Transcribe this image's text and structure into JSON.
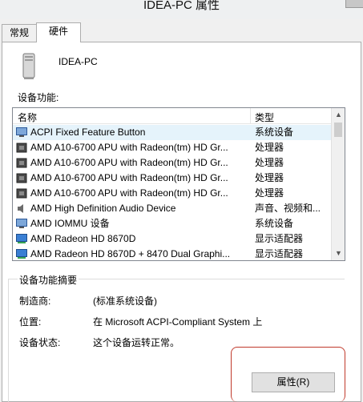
{
  "window": {
    "title": "IDEA-PC 属性"
  },
  "tabs": [
    {
      "label": "常规"
    },
    {
      "label": "硬件"
    }
  ],
  "computer": {
    "name": "IDEA-PC",
    "icon": "computer-tower-icon"
  },
  "device_functions": {
    "label": "设备功能:",
    "columns": {
      "name": "名称",
      "type": "类型"
    },
    "rows": [
      {
        "name": "ACPI Fixed Feature Button",
        "type": "系统设备",
        "icon": "system-device-icon"
      },
      {
        "name": "AMD A10-6700 APU with Radeon(tm) HD Gr...",
        "type": "处理器",
        "icon": "processor-icon"
      },
      {
        "name": "AMD A10-6700 APU with Radeon(tm) HD Gr...",
        "type": "处理器",
        "icon": "processor-icon"
      },
      {
        "name": "AMD A10-6700 APU with Radeon(tm) HD Gr...",
        "type": "处理器",
        "icon": "processor-icon"
      },
      {
        "name": "AMD A10-6700 APU with Radeon(tm) HD Gr...",
        "type": "处理器",
        "icon": "processor-icon"
      },
      {
        "name": "AMD High Definition Audio Device",
        "type": "声音、视频和...",
        "icon": "speaker-icon"
      },
      {
        "name": "AMD IOMMU 设备",
        "type": "系统设备",
        "icon": "system-device-icon"
      },
      {
        "name": "AMD Radeon HD 8670D",
        "type": "显示适配器",
        "icon": "display-adapter-icon"
      },
      {
        "name": "AMD Radeon HD 8670D + 8470 Dual Graphi...",
        "type": "显示适配器",
        "icon": "display-adapter-icon"
      }
    ]
  },
  "summary": {
    "title": "设备功能摘要",
    "manufacturer_label": "制造商:",
    "manufacturer_value": "(标准系统设备)",
    "location_label": "位置:",
    "location_value": "在 Microsoft ACPI-Compliant System 上",
    "status_label": "设备状态:",
    "status_value": "这个设备运转正常。"
  },
  "buttons": {
    "properties": "属性(R)"
  },
  "colors": {
    "highlight_border": "#c0392b",
    "selected_row": "#e5f3fb"
  }
}
